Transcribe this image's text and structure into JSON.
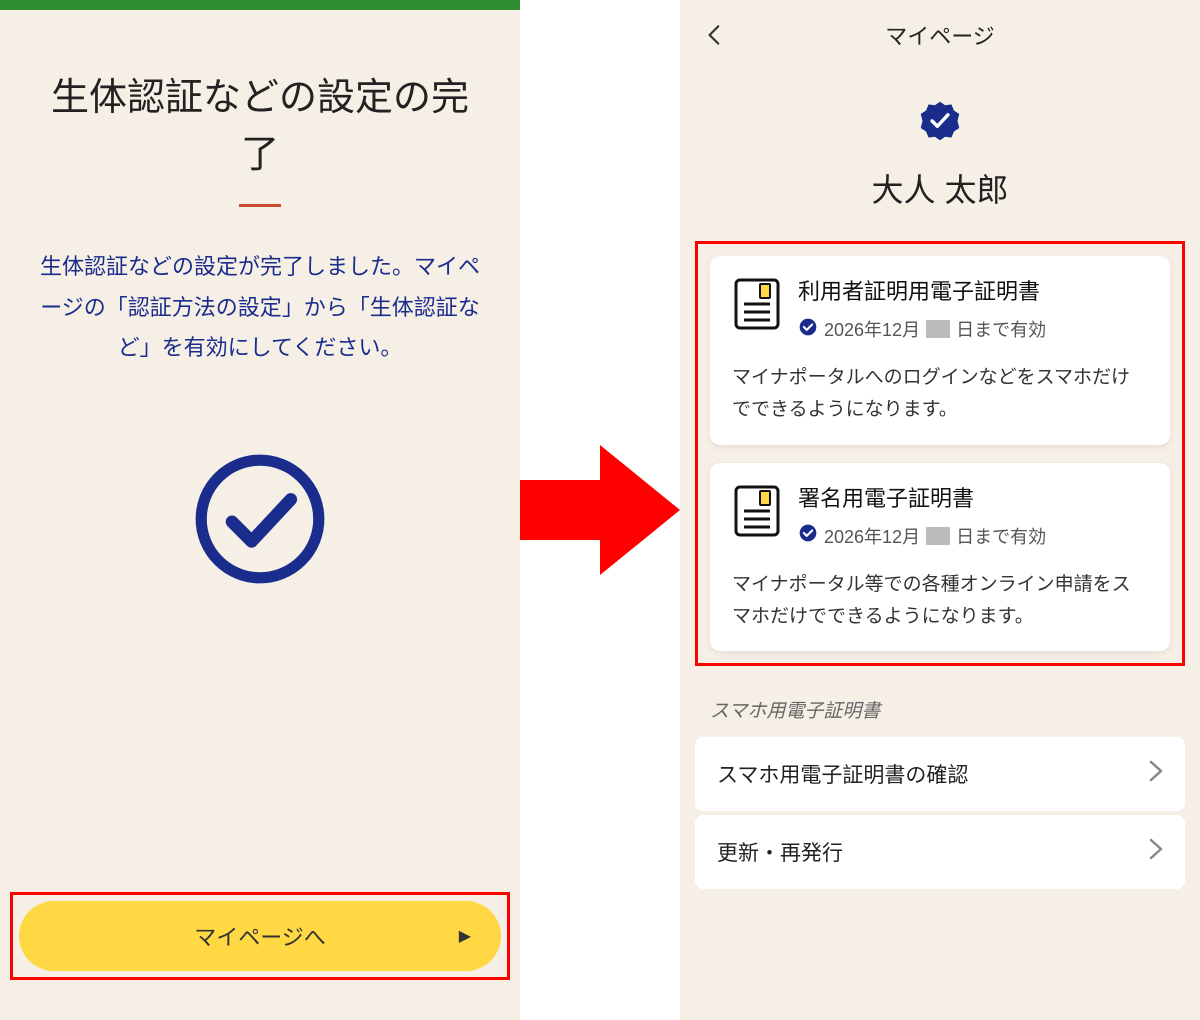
{
  "left": {
    "title": "生体認証などの設定の完了",
    "body": "生体認証などの設定が完了しました。マイページの「認証方法の設定」から「生体認証など」を有効にしてください。",
    "button_label": "マイページへ"
  },
  "right": {
    "header_title": "マイページ",
    "profile_name": "大人 太郎",
    "cards": [
      {
        "title": "利用者証明用電子証明書",
        "valid_prefix": "2026年12月",
        "valid_suffix": "日まで有効",
        "desc": "マイナポータルへのログインなどをスマホだけでできるようになります。"
      },
      {
        "title": "署名用電子証明書",
        "valid_prefix": "2026年12月",
        "valid_suffix": "日まで有効",
        "desc": "マイナポータル等での各種オンライン申請をスマホだけでできるようになります。"
      }
    ],
    "section_label": "スマホ用電子証明書",
    "menu": [
      "スマホ用電子証明書の確認",
      "更新・再発行"
    ]
  },
  "colors": {
    "accent_blue": "#1a2c8c",
    "highlight_red": "#ff0000",
    "button_yellow": "#ffd843"
  }
}
